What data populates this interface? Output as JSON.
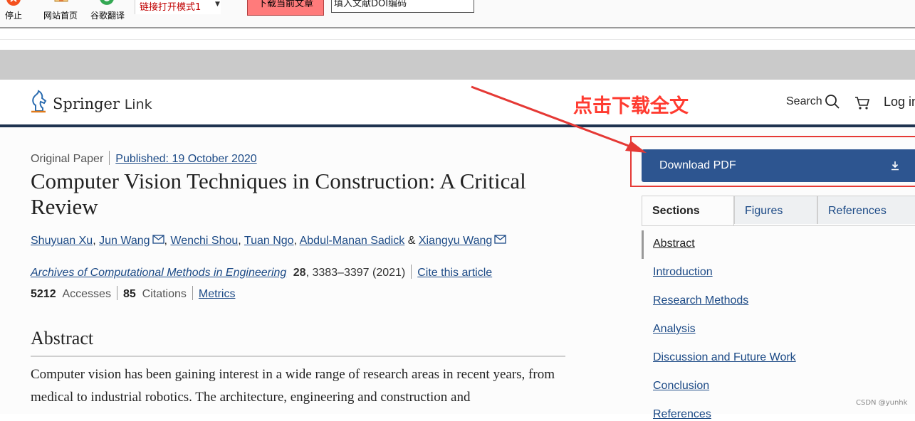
{
  "toolbar": {
    "stop_label": "停止",
    "home_label": "网站首页",
    "translate_label": "谷歌翻译",
    "mode_select_value": "链接打开模式1",
    "download_current_label": "下载当前文章",
    "doi_input_value": "填入文献DOI编码"
  },
  "header": {
    "logo_springer": "Springer",
    "logo_link": "Link",
    "annotation": "点击下载全文",
    "search_label": "Search",
    "login_label": "Log in"
  },
  "article": {
    "type": "Original Paper",
    "published": "Published: 19 October 2020",
    "title": "Computer Vision Techniques in Construction: A Critical Review",
    "authors": [
      "Shuyuan Xu",
      "Jun Wang",
      "Wenchi Shou",
      "Tuan Ngo",
      "Abdul-Manan Sadick",
      "Xiangyu Wang"
    ],
    "author_sep": ", ",
    "author_and": "&",
    "journal": "Archives of Computational Methods in Engineering",
    "volume": "28",
    "pages_year": ", 3383–3397 (2021)",
    "cite_label": "Cite this article",
    "accesses_count": "5212",
    "accesses_label": "Accesses",
    "citations_count": "85",
    "citations_label": "Citations",
    "metrics_label": "Metrics",
    "abstract_heading": "Abstract",
    "abstract_text": "Computer vision has been gaining interest in a wide range of research areas in recent years, from medical to industrial robotics. The architecture, engineering and construction and"
  },
  "sidebar": {
    "download_pdf_label": "Download PDF",
    "tabs": [
      "Sections",
      "Figures",
      "References"
    ],
    "sections": [
      "Abstract",
      "Introduction",
      "Research Methods",
      "Analysis",
      "Discussion and Future Work",
      "Conclusion",
      "References"
    ]
  },
  "watermark": "CSDN @yunhk",
  "colors": {
    "accent_blue": "#2d5590",
    "link_blue": "#1c4a86",
    "annotation_red": "#ff3b30",
    "header_rule": "#1f3350"
  }
}
